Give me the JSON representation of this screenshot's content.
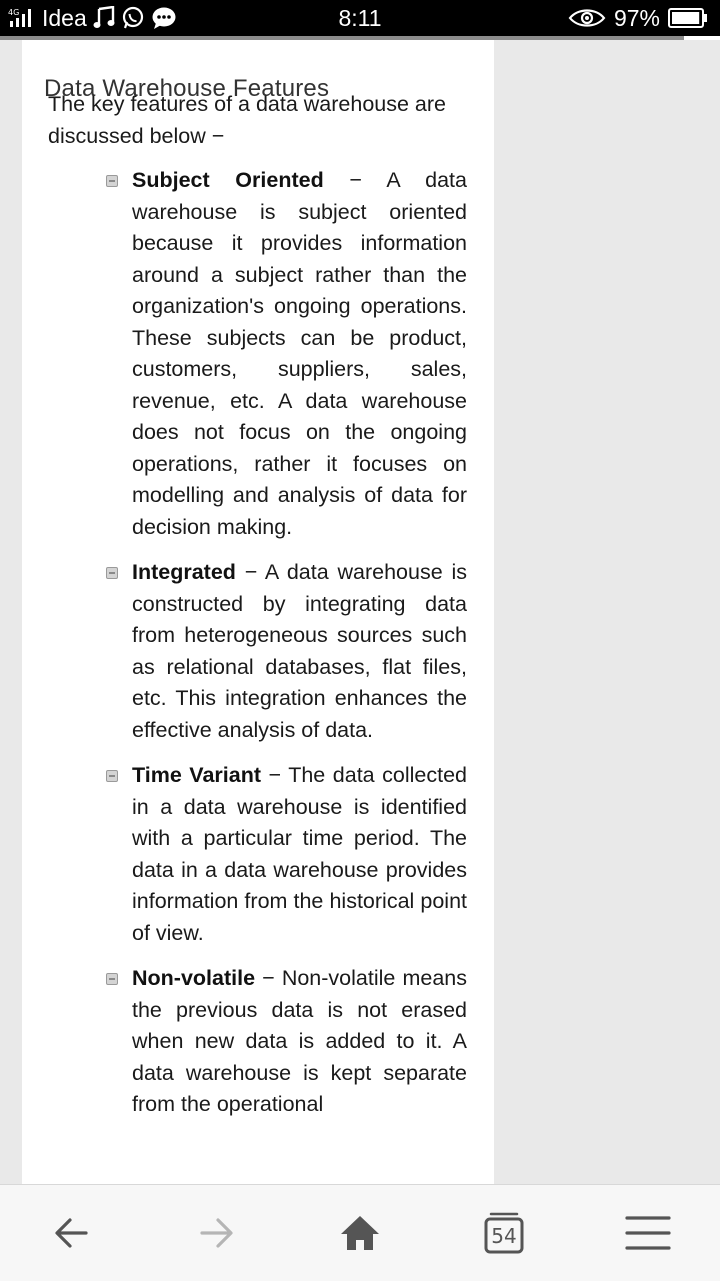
{
  "status_bar": {
    "carrier": "Idea",
    "time": "8:11",
    "battery": "97%",
    "battery_level": 0.97,
    "icons": [
      "signal-icon",
      "music-icon",
      "whatsapp-icon",
      "chat-icon",
      "eye-icon",
      "battery-icon"
    ]
  },
  "page": {
    "title": "Data Warehouse Features",
    "intro": "The key features of a data warehouse are discussed below −",
    "features": [
      {
        "term": "Subject Oriented",
        "text": " − A data warehouse is subject oriented because it provides information around a subject rather than the organization's ongoing operations. These subjects can be product, customers, suppliers, sales, revenue, etc. A data warehouse does not focus on the ongoing operations, rather it focuses on modelling and analysis of data for decision making."
      },
      {
        "term": "Integrated",
        "text": " − A data warehouse is constructed by integrating data from heterogeneous sources such as relational databases, flat files, etc. This integration enhances the effective analysis of data."
      },
      {
        "term": "Time Variant",
        "text": " − The data collected in a data warehouse is identified with a particular time period. The data in a data warehouse provides information from the historical point of view."
      },
      {
        "term": "Non-volatile",
        "text": " − Non-volatile means the previous data is not erased when new data is added to it. A data warehouse is kept separate from the operational"
      }
    ]
  },
  "bottom_nav": {
    "tab_count": "54",
    "icons": [
      "back-arrow-icon",
      "forward-arrow-icon",
      "home-icon",
      "tabs-icon",
      "menu-icon"
    ]
  }
}
